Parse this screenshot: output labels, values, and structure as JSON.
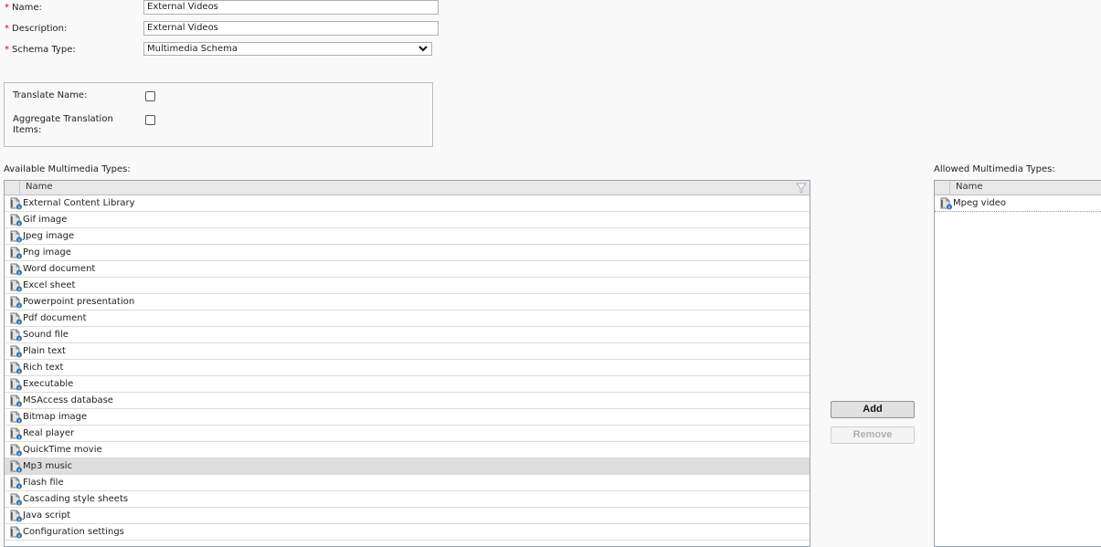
{
  "form": {
    "name": {
      "label": "Name:",
      "required": true,
      "value": "External Videos"
    },
    "description": {
      "label": "Description:",
      "required": true,
      "value": "External Videos"
    },
    "schema_type": {
      "label": "Schema Type:",
      "required": true,
      "selected": "Multimedia Schema"
    },
    "required_marker": "*"
  },
  "translation": {
    "translate_name": {
      "label": "Translate Name:",
      "checked": false
    },
    "aggregate_items": {
      "label_line1": "Aggregate Translation",
      "label_line2": "Items:",
      "checked": false
    }
  },
  "available": {
    "title": "Available Multimedia Types:",
    "column": "Name",
    "selected_index": 16,
    "items": [
      "External Content Library",
      "Gif image",
      "Jpeg image",
      "Png image",
      "Word document",
      "Excel sheet",
      "Powerpoint presentation",
      "Pdf document",
      "Sound file",
      "Plain text",
      "Rich text",
      "Executable",
      "MSAccess database",
      "Bitmap image",
      "Real player",
      "QuickTime movie",
      "Mp3 music",
      "Flash file",
      "Cascading style sheets",
      "Java script",
      "Configuration settings"
    ]
  },
  "allowed": {
    "title": "Allowed Multimedia Types:",
    "column": "Name",
    "items": [
      "Mpeg video"
    ]
  },
  "buttons": {
    "add": "Add",
    "remove": "Remove",
    "remove_enabled": false
  }
}
